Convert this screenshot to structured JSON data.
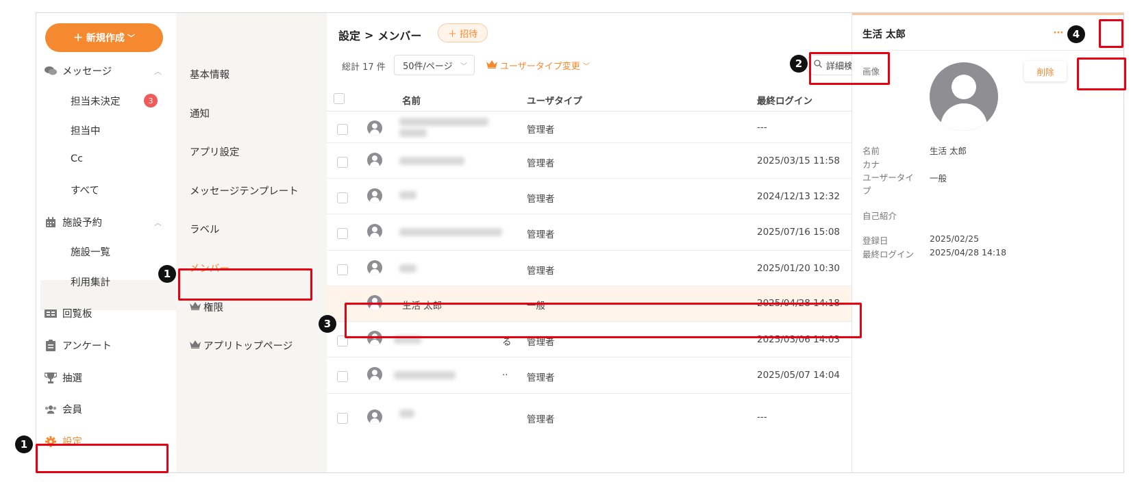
{
  "nav": {
    "new_label": "＋ 新規作成",
    "items": [
      {
        "label": "メッセージ",
        "icon": "chat-bubbles-icon"
      },
      {
        "label": "施設予約",
        "icon": "calendar-icon"
      },
      {
        "label": "回覧板",
        "icon": "board-icon"
      },
      {
        "label": "アンケート",
        "icon": "clipboard-icon"
      },
      {
        "label": "抽選",
        "icon": "trophy-icon"
      },
      {
        "label": "会員",
        "icon": "users-icon"
      },
      {
        "label": "設定",
        "icon": "gear-icon"
      }
    ],
    "message_sub": [
      "担当未決定",
      "担当中",
      "Cc",
      "すべて"
    ],
    "unassigned_badge": "3",
    "facility_sub": [
      "施設一覧",
      "利用集計"
    ]
  },
  "submenu": {
    "items": [
      "基本情報",
      "通知",
      "アプリ設定",
      "メッセージテンプレート",
      "ラベル",
      "メンバー",
      "権限",
      "アプリトップページ"
    ]
  },
  "main": {
    "breadcrumb_parent": "設定",
    "breadcrumb_sep": ">",
    "breadcrumb_current": "メンバー",
    "invite_label": "＋ 招待",
    "total": "総計 17 件",
    "per_page": "50件/ページ",
    "type_change": "ユーザータイプ変更",
    "advanced_search": "詳細検索",
    "columns": {
      "name": "名前",
      "type": "ユーザタイプ",
      "last_login": "最終ログイン"
    },
    "rows": [
      {
        "name": "",
        "type": "管理者",
        "last_login": "---"
      },
      {
        "name": "",
        "type": "管理者",
        "last_login": "2025/03/15 11:58"
      },
      {
        "name": "",
        "type": "管理者",
        "last_login": "2024/12/13 12:32"
      },
      {
        "name": "",
        "type": "管理者",
        "last_login": "2025/07/16 15:08"
      },
      {
        "name": "",
        "type": "管理者",
        "last_login": "2025/01/20 10:30"
      },
      {
        "name": "生活 太郎",
        "type": "一般",
        "last_login": "2025/04/28 14:18"
      },
      {
        "name": "る",
        "type": "管理者",
        "last_login": "2025/03/06 14:03"
      },
      {
        "name": "··",
        "type": "管理者",
        "last_login": "2025/05/07 14:04"
      },
      {
        "name": "",
        "type": "管理者",
        "last_login": "---"
      }
    ]
  },
  "detail": {
    "title": "生活 太郎",
    "more": "···",
    "delete": "削除",
    "image_label": "画像",
    "name_label": "名前",
    "name_value": "生活 太郎",
    "kana_label": "カナ",
    "type_label": "ユーザータイ\nプ",
    "type_value": "一般",
    "intro_label": "自己紹介",
    "registered_label": "登録日",
    "registered_value": "2025/02/25",
    "last_login_label": "最終ログイン",
    "last_login_value": "2025/04/28 14:18"
  },
  "markers": [
    "1",
    "1",
    "2",
    "3",
    "4"
  ],
  "colors": {
    "accent": "#f5892f",
    "annotation": "#e60012",
    "selected_row": "#fff4ea"
  }
}
